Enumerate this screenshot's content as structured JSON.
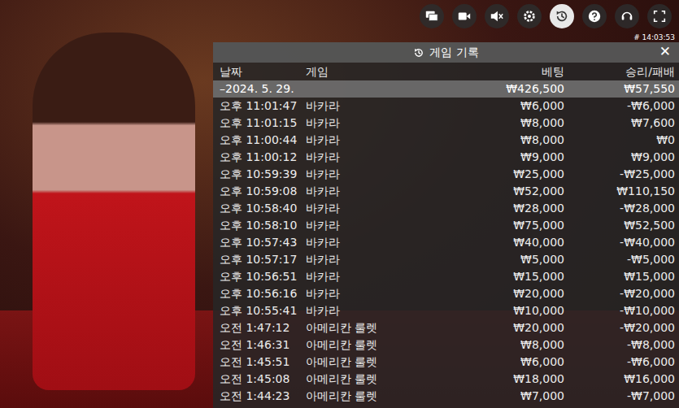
{
  "toolbar": [
    {
      "selected": false
    },
    {
      "selected": false
    },
    {
      "selected": false
    },
    {
      "selected": false
    },
    {
      "selected": true
    },
    {
      "selected": false
    },
    {
      "selected": false
    },
    {
      "selected": false
    }
  ],
  "clock": "# 14:03:53",
  "panel": {
    "title": "게임 기록",
    "close": "✕"
  },
  "columns": [
    "날짜",
    "게임",
    "베팅",
    "승리/패배"
  ],
  "summary": {
    "date": "–2024. 5. 29.",
    "bet": "₩426,500",
    "result": "₩57,550"
  },
  "rows": [
    {
      "time": "오후 11:01:47",
      "game": "바카라",
      "bet": "₩6,000",
      "result": "-₩6,000"
    },
    {
      "time": "오후 11:01:15",
      "game": "바카라",
      "bet": "₩8,000",
      "result": "₩7,600"
    },
    {
      "time": "오후 11:00:44",
      "game": "바카라",
      "bet": "₩8,000",
      "result": "₩0"
    },
    {
      "time": "오후 11:00:12",
      "game": "바카라",
      "bet": "₩9,000",
      "result": "₩9,000"
    },
    {
      "time": "오후 10:59:39",
      "game": "바카라",
      "bet": "₩25,000",
      "result": "-₩25,000"
    },
    {
      "time": "오후 10:59:08",
      "game": "바카라",
      "bet": "₩52,000",
      "result": "₩110,150"
    },
    {
      "time": "오후 10:58:40",
      "game": "바카라",
      "bet": "₩28,000",
      "result": "-₩28,000"
    },
    {
      "time": "오후 10:58:10",
      "game": "바카라",
      "bet": "₩75,000",
      "result": "₩52,500"
    },
    {
      "time": "오후 10:57:43",
      "game": "바카라",
      "bet": "₩40,000",
      "result": "-₩40,000"
    },
    {
      "time": "오후 10:57:17",
      "game": "바카라",
      "bet": "₩5,000",
      "result": "-₩5,000"
    },
    {
      "time": "오후 10:56:51",
      "game": "바카라",
      "bet": "₩15,000",
      "result": "₩15,000"
    },
    {
      "time": "오후 10:56:16",
      "game": "바카라",
      "bet": "₩20,000",
      "result": "-₩20,000"
    },
    {
      "time": "오후 10:55:41",
      "game": "바카라",
      "bet": "₩10,000",
      "result": "-₩10,000"
    },
    {
      "time": "오전 1:47:12",
      "game": "아메리칸 룰렛",
      "bet": "₩20,000",
      "result": "-₩20,000"
    },
    {
      "time": "오전 1:46:31",
      "game": "아메리칸 룰렛",
      "bet": "₩8,000",
      "result": "-₩8,000"
    },
    {
      "time": "오전 1:45:51",
      "game": "아메리칸 룰렛",
      "bet": "₩6,000",
      "result": "-₩6,000"
    },
    {
      "time": "오전 1:45:08",
      "game": "아메리칸 룰렛",
      "bet": "₩18,000",
      "result": "₩16,000"
    },
    {
      "time": "오전 1:44:23",
      "game": "아메리칸 룰렛",
      "bet": "₩7,000",
      "result": "-₩7,000"
    }
  ]
}
